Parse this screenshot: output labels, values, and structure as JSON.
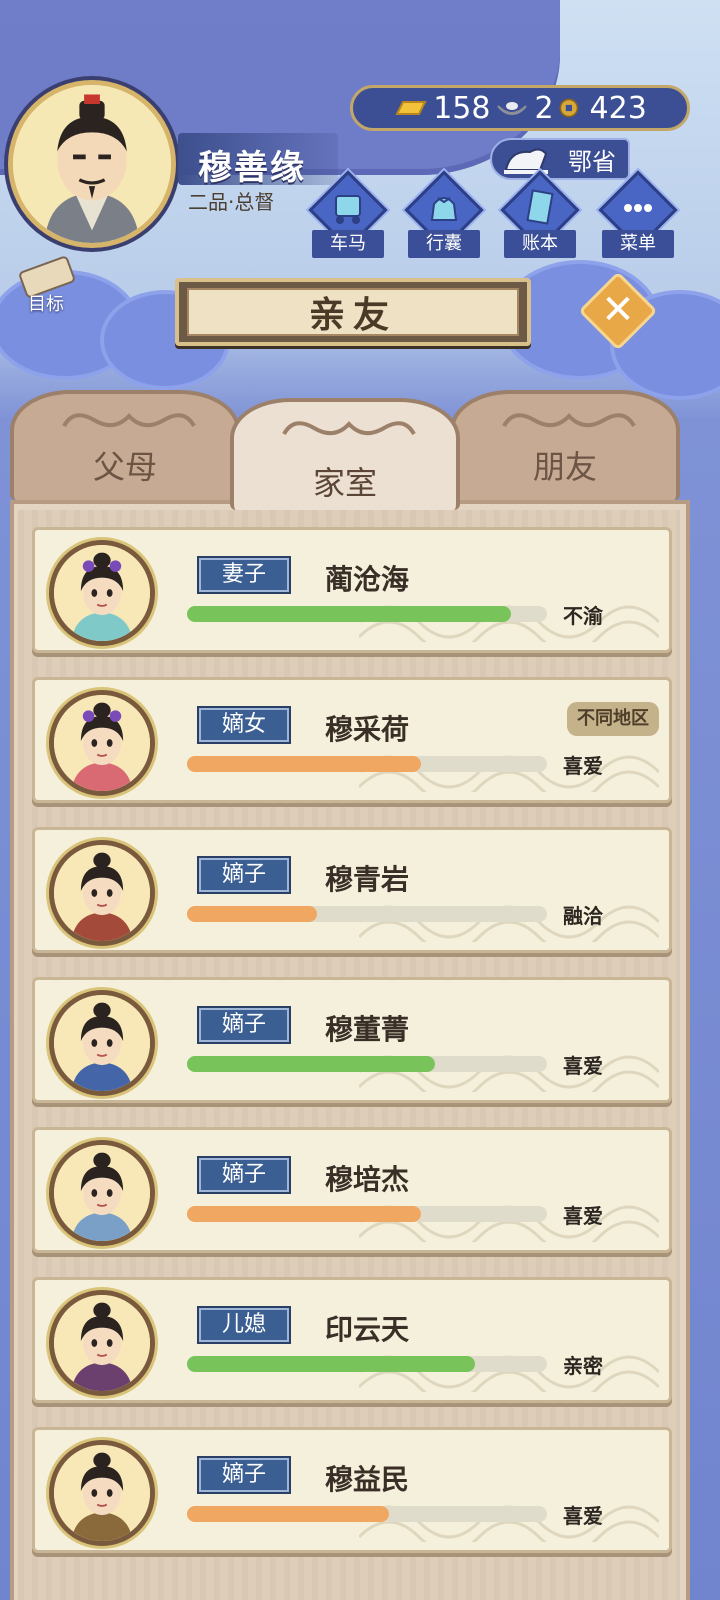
{
  "player": {
    "name": "穆善缘",
    "rank": "二品·总督",
    "avatar_icon": "male-official-portrait"
  },
  "currency": {
    "gold": "158",
    "silver": "2",
    "coins": "423"
  },
  "region": "鄂省",
  "menu": [
    {
      "label": "车马",
      "icon": "carriage-icon"
    },
    {
      "label": "行囊",
      "icon": "bag-icon"
    },
    {
      "label": "账本",
      "icon": "ledger-icon"
    },
    {
      "label": "菜单",
      "icon": "more-icon"
    }
  ],
  "goal_label": "目标",
  "title": "亲友",
  "tabs": [
    {
      "label": "父母"
    },
    {
      "label": "家室"
    },
    {
      "label": "朋友"
    }
  ],
  "active_tab": "家室",
  "relations": [
    {
      "role": "妻子",
      "name": "蔺沧海",
      "mood": "不渝",
      "tag": "",
      "level": 0.9,
      "color": "#79c45a"
    },
    {
      "role": "嫡女",
      "name": "穆采荷",
      "mood": "喜爱",
      "tag": "不同地区",
      "level": 0.65,
      "color": "#f0a762"
    },
    {
      "role": "嫡子",
      "name": "穆青岩",
      "mood": "融洽",
      "tag": "",
      "level": 0.36,
      "color": "#f0a762"
    },
    {
      "role": "嫡子",
      "name": "穆董菁",
      "mood": "喜爱",
      "tag": "",
      "level": 0.69,
      "color": "#79c45a"
    },
    {
      "role": "嫡子",
      "name": "穆培杰",
      "mood": "喜爱",
      "tag": "",
      "level": 0.65,
      "color": "#f0a762"
    },
    {
      "role": "儿媳",
      "name": "印云天",
      "mood": "亲密",
      "tag": "",
      "level": 0.8,
      "color": "#79c45a"
    },
    {
      "role": "嫡子",
      "name": "穆益民",
      "mood": "喜爱",
      "tag": "",
      "level": 0.56,
      "color": "#f0a762"
    }
  ]
}
